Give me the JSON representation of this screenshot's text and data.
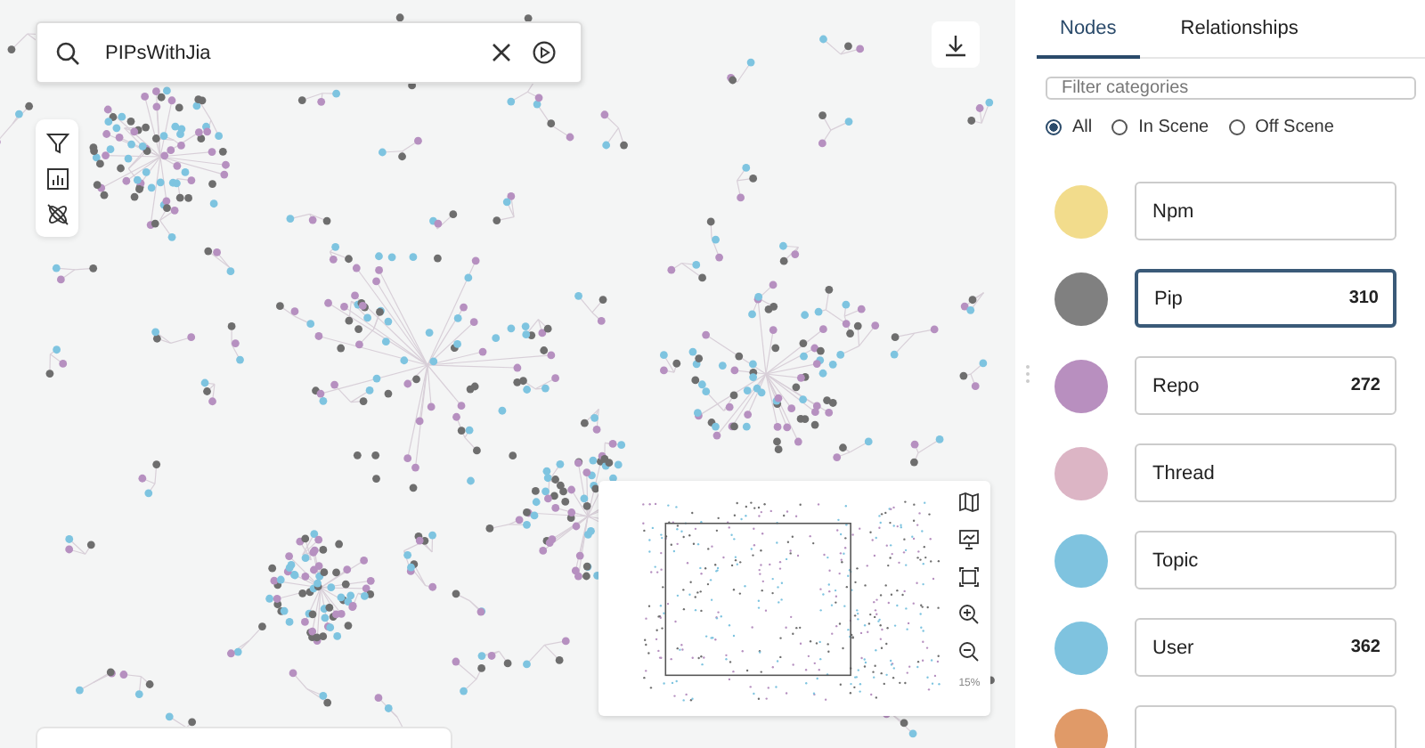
{
  "search": {
    "value": "PIPsWithJia"
  },
  "tabs": [
    {
      "label": "Nodes",
      "selected": true
    },
    {
      "label": "Relationships",
      "selected": false
    }
  ],
  "filter": {
    "placeholder": "Filter categories"
  },
  "scope_options": [
    {
      "label": "All",
      "selected": true
    },
    {
      "label": "In Scene",
      "selected": false
    },
    {
      "label": "Off Scene",
      "selected": false
    }
  ],
  "categories": [
    {
      "name": "Npm",
      "color": "#f2dc8c",
      "selected": false
    },
    {
      "name": "Pip",
      "count": "310",
      "color": "#808080",
      "selected": true
    },
    {
      "name": "Repo",
      "count": "272",
      "color": "#b88fbf",
      "selected": false
    },
    {
      "name": "Thread",
      "color": "#dcb5c5",
      "selected": false
    },
    {
      "name": "Topic",
      "color": "#7fc3df",
      "selected": false
    },
    {
      "name": "User",
      "count": "362",
      "color": "#7fc3df",
      "selected": false
    },
    {
      "color": "#e09a68",
      "selected": false
    }
  ],
  "minimap": {
    "zoom": "15%"
  }
}
